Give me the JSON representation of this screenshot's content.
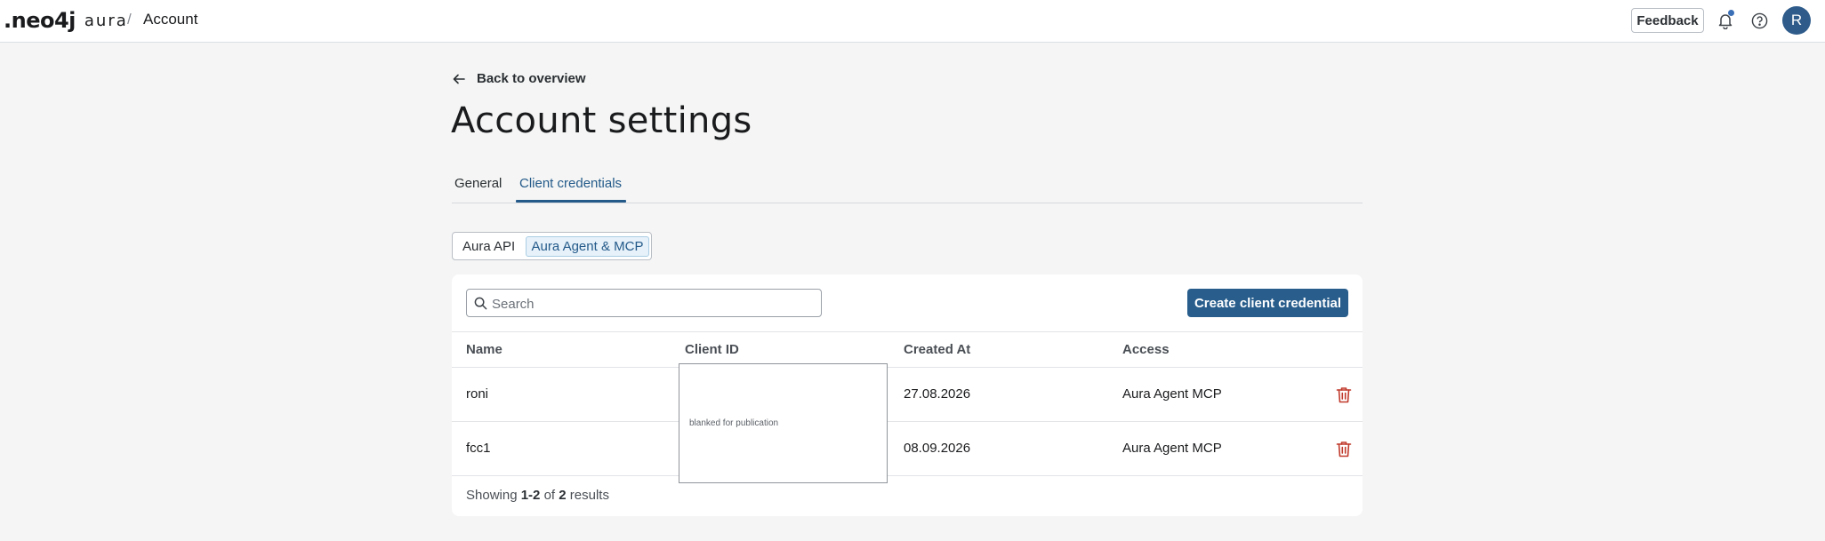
{
  "header": {
    "logo_neo": ".neo4j",
    "logo_aura": "aura",
    "breadcrumb_separator": "/",
    "breadcrumb_current": "Account",
    "feedback_label": "Feedback",
    "avatar_initial": "R",
    "icons": [
      "bell-icon",
      "help-icon"
    ]
  },
  "page": {
    "back_label": "Back to overview",
    "title": "Account settings"
  },
  "tabs": [
    {
      "label": "General",
      "active": false
    },
    {
      "label": "Client credentials",
      "active": true
    }
  ],
  "segmented": {
    "options": [
      {
        "label": "Aura API",
        "selected": false
      },
      {
        "label": "Aura Agent & MCP",
        "selected": true
      }
    ]
  },
  "search": {
    "placeholder": "Search",
    "value": ""
  },
  "create_button_label": "Create client credential",
  "table": {
    "columns": [
      "Name",
      "Client ID",
      "Created At",
      "Access"
    ],
    "rows": [
      {
        "name": "roni",
        "client_id": "",
        "created_at": "27.08.2026",
        "access": "Aura Agent MCP"
      },
      {
        "name": "fcc1",
        "client_id": "",
        "created_at": "08.09.2026",
        "access": "Aura Agent MCP"
      }
    ]
  },
  "redaction_note": "blanked for publication",
  "footer": {
    "prefix": "Showing ",
    "range": "1-2",
    "of": " of ",
    "total": "2",
    "suffix": " results"
  },
  "colors": {
    "accent": "#285d8c",
    "danger_icon": "#c0392b",
    "background": "#f4f5f4"
  }
}
